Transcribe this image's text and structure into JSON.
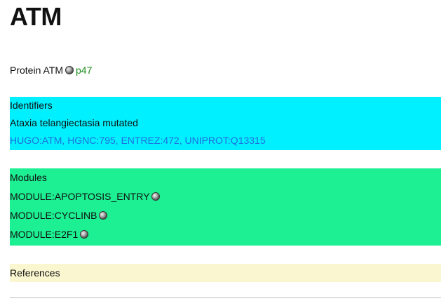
{
  "title": "ATM",
  "protein": {
    "label": "Protein ATM",
    "icon": "module-bead-icon",
    "link_text": "p47",
    "link_color": "#1a8a1a"
  },
  "identifiers": {
    "header": "Identifiers",
    "full_name": "Ataxia telangiectasia mutated",
    "links": [
      "HUGO:ATM",
      "HGNC:795",
      "ENTREZ:472",
      "UNIPROT:Q13315"
    ],
    "background": "#00f0ff",
    "link_color": "#1f6fe0"
  },
  "modules": {
    "header": "Modules",
    "items": [
      "MODULE:APOPTOSIS_ENTRY",
      "MODULE:CYCLINB",
      "MODULE:E2F1"
    ],
    "item_icon": "module-bead-icon",
    "background": "#1df093"
  },
  "references": {
    "header": "References",
    "background": "#faf6d0"
  }
}
